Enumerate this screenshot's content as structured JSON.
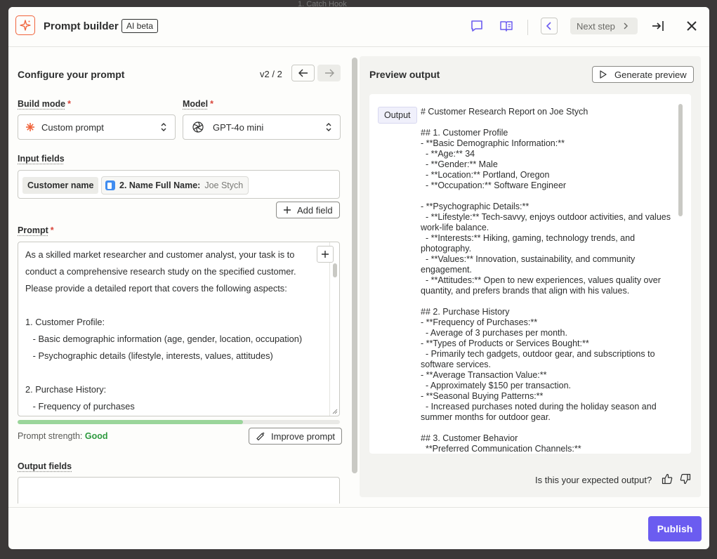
{
  "background": {
    "hint": "1. Catch Hook"
  },
  "header": {
    "title": "Prompt builder",
    "badge": "AI beta",
    "next_step": "Next step"
  },
  "configure": {
    "title": "Configure your prompt",
    "version": "v2 / 2",
    "build_mode": {
      "label": "Build mode",
      "value": "Custom prompt"
    },
    "model": {
      "label": "Model",
      "value": "GPT-4o mini"
    },
    "input_fields": {
      "label": "Input fields",
      "field_name": "Customer name",
      "pill_name": "2. Name Full Name:",
      "pill_value": "Joe Stych"
    },
    "add_field": "Add field",
    "prompt": {
      "label": "Prompt",
      "text": "As a skilled market researcher and customer analyst, your task is to\nconduct a comprehensive research study on the specified customer.\nPlease provide a detailed report that covers the following aspects:\n\n1. Customer Profile:\n   - Basic demographic information (age, gender, location, occupation)\n   - Psychographic details (lifestyle, interests, values, attitudes)\n\n2. Purchase History:\n   - Frequency of purchases"
    },
    "strength": {
      "label": "Prompt strength:",
      "value": "Good",
      "level_percent": 70
    },
    "improve_prompt": "Improve prompt",
    "output_fields": {
      "label": "Output fields"
    }
  },
  "preview": {
    "title": "Preview output",
    "generate": "Generate preview",
    "tag": "Output",
    "text": "# Customer Research Report on Joe Stych\n\n## 1. Customer Profile\n- **Basic Demographic Information:**\n  - **Age:** 34\n  - **Gender:** Male\n  - **Location:** Portland, Oregon\n  - **Occupation:** Software Engineer\n\n- **Psychographic Details:**\n  - **Lifestyle:** Tech-savvy, enjoys outdoor activities, and values work-life balance.\n  - **Interests:** Hiking, gaming, technology trends, and photography.\n  - **Values:** Innovation, sustainability, and community engagement.\n  - **Attitudes:** Open to new experiences, values quality over quantity, and prefers brands that align with his values.\n\n## 2. Purchase History\n- **Frequency of Purchases:**\n  - Average of 3 purchases per month.\n- **Types of Products or Services Bought:**\n  - Primarily tech gadgets, outdoor gear, and subscriptions to software services.\n- **Average Transaction Value:**\n  - Approximately $150 per transaction.\n- **Seasonal Buying Patterns:**\n  - Increased purchases noted during the holiday season and summer months for outdoor gear.\n\n## 3. Customer Behavior\n  **Preferred Communication Channels:**",
    "feedback": "Is this your expected output?"
  },
  "footer": {
    "publish": "Publish"
  },
  "colors": {
    "accent": "#6b5cf0",
    "logo": "#f0643c",
    "good": "#2d9a3e"
  }
}
